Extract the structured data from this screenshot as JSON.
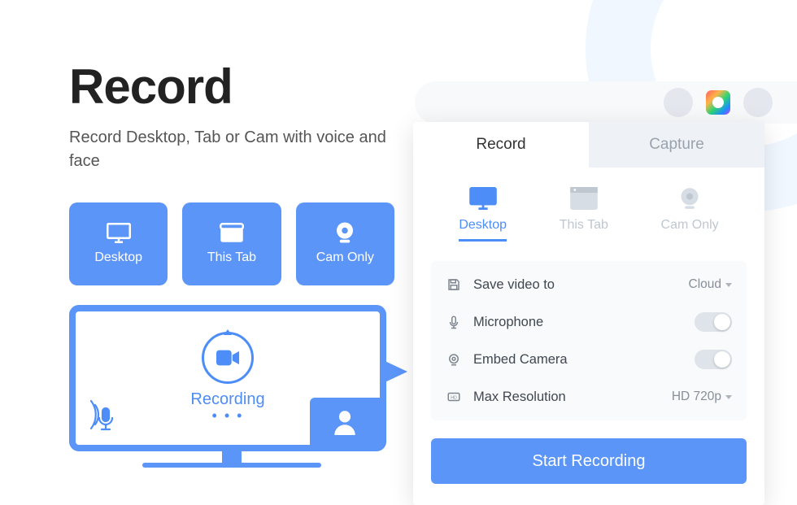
{
  "hero": {
    "title": "Record",
    "subtitle": "Record Desktop, Tab or Cam with voice and face"
  },
  "mode_cards": [
    {
      "label": "Desktop"
    },
    {
      "label": "This Tab"
    },
    {
      "label": "Cam Only"
    }
  ],
  "monitor": {
    "status": "Recording",
    "dots": "• • •"
  },
  "popup": {
    "tabs": {
      "record": "Record",
      "capture": "Capture"
    },
    "sources": [
      {
        "label": "Desktop",
        "active": true
      },
      {
        "label": "This Tab",
        "active": false
      },
      {
        "label": "Cam Only",
        "active": false
      }
    ],
    "settings": {
      "save_to": {
        "label": "Save video to",
        "value": "Cloud"
      },
      "microphone": {
        "label": "Microphone"
      },
      "embed_camera": {
        "label": "Embed Camera"
      },
      "max_resolution": {
        "label": "Max Resolution",
        "value": "HD 720p"
      }
    },
    "start_button": "Start Recording"
  }
}
